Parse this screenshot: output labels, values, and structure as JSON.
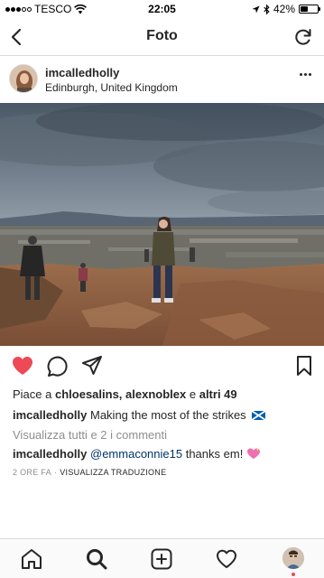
{
  "status_bar": {
    "carrier": "TESCO",
    "time": "22:05",
    "battery": "42%",
    "battery_level": 0.42,
    "icons": [
      "signal-icon",
      "wifi-icon",
      "location-arrow-icon",
      "bluetooth-icon",
      "battery-icon"
    ]
  },
  "nav": {
    "title": "Foto",
    "back_icon": "chevron-left-icon",
    "refresh_icon": "refresh-icon"
  },
  "post": {
    "username": "imcalledholly",
    "location": "Edinburgh, United Kingdom",
    "more_icon": "more-horizontal-icon"
  },
  "actions": {
    "icons": [
      "heart-filled-icon",
      "comment-icon",
      "share-icon",
      "bookmark-icon"
    ],
    "like_color": "#ed4956"
  },
  "likes": {
    "prefix": "Piace a",
    "users": "chloesalins, alexnoblex",
    "conjunction": "e",
    "others": "altri 49"
  },
  "caption": {
    "username": "imcalledholly",
    "text": "Making the most of the strikes"
  },
  "view_comments": "Visualizza tutti e 2 i commenti",
  "comment": {
    "username": "imcalledholly",
    "mention": "@emmaconnie15",
    "text": "thanks em!"
  },
  "meta": {
    "time_ago": "2 ORE FA",
    "translate": "VISUALIZZA TRADUZIONE"
  },
  "tab_bar": {
    "icons": [
      "home-icon",
      "search-icon",
      "add-post-icon",
      "activity-heart-icon",
      "profile-avatar"
    ]
  }
}
